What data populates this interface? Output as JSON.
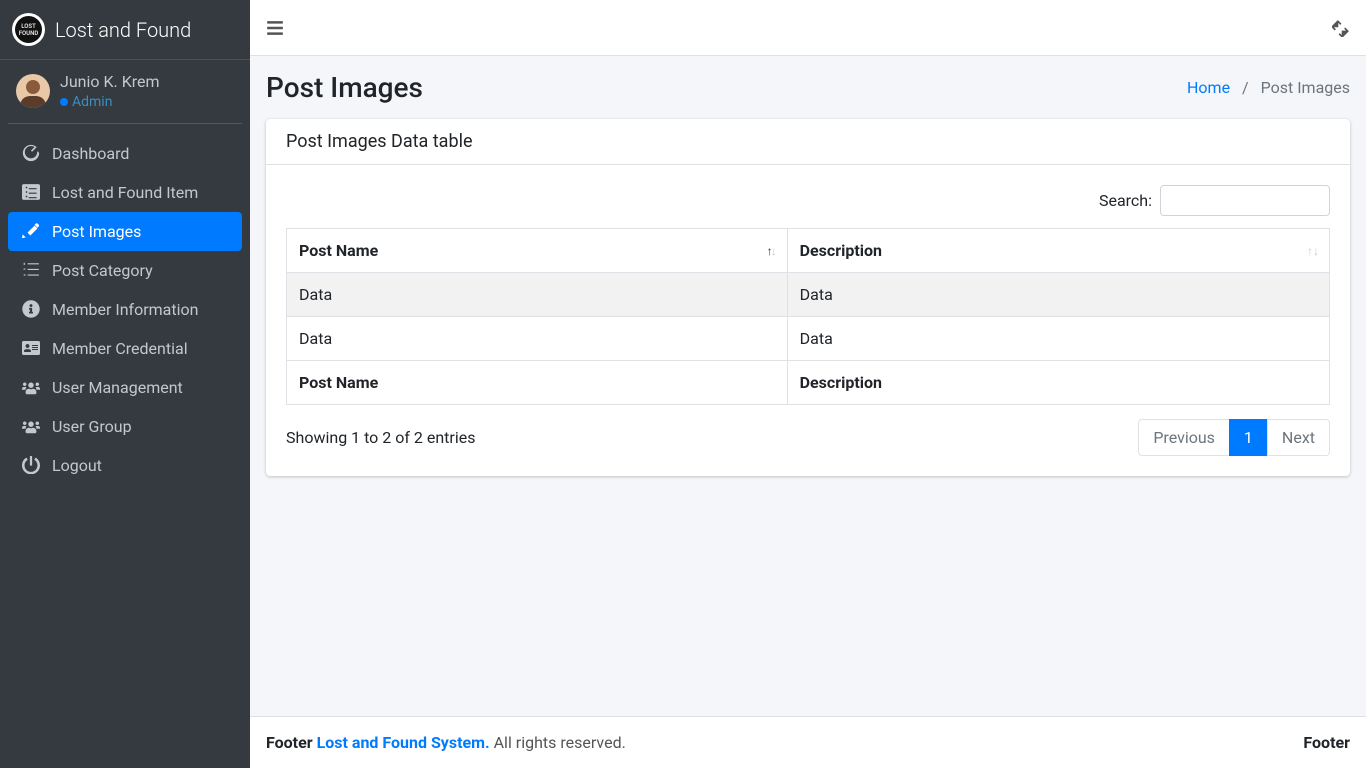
{
  "brand": {
    "title": "Lost and Found",
    "logo_text": "LOST\nFOUND"
  },
  "user": {
    "name": "Junio K. Krem",
    "role": "Admin"
  },
  "sidebar": {
    "items": [
      {
        "label": "Dashboard"
      },
      {
        "label": "Lost and Found Item"
      },
      {
        "label": "Post Images"
      },
      {
        "label": "Post Category"
      },
      {
        "label": "Member Information"
      },
      {
        "label": "Member Credential"
      },
      {
        "label": "User Management"
      },
      {
        "label": "User Group"
      },
      {
        "label": "Logout"
      }
    ]
  },
  "header": {
    "title": "Post Images",
    "breadcrumb_home": "Home",
    "breadcrumb_current": "Post Images"
  },
  "card": {
    "title": "Post Images Data table"
  },
  "datatable": {
    "search_label": "Search:",
    "search_value": "",
    "columns": [
      "Post Name",
      "Description"
    ],
    "rows": [
      {
        "post_name": "Data",
        "description": "Data"
      },
      {
        "post_name": "Data",
        "description": "Data"
      }
    ],
    "footer_cols": [
      "Post Name",
      "Description"
    ],
    "info": "Showing 1 to 2 of 2 entries",
    "pagination": {
      "previous": "Previous",
      "current": "1",
      "next": "Next"
    }
  },
  "footer": {
    "prefix": "Footer ",
    "link": "Lost and Found System.",
    "suffix": " All rights reserved.",
    "right": "Footer"
  }
}
